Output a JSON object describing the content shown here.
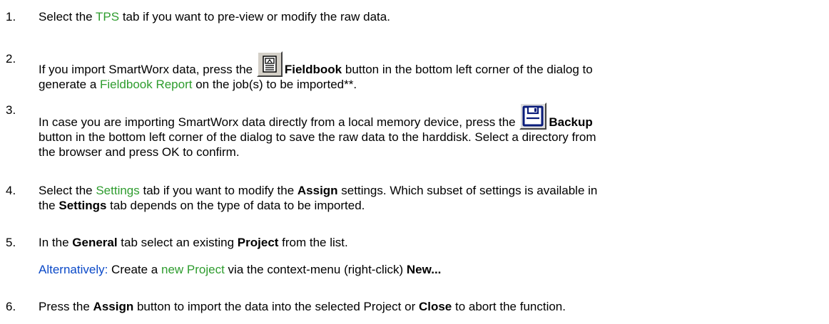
{
  "steps": [
    {
      "number": "1.",
      "pre": "Select the ",
      "link": "TPS",
      "post": " tab if you want to pre-view or modify the raw data."
    },
    {
      "number": "2.",
      "pre": "If you import SmartWorx data, press the ",
      "button": "Fieldbook",
      "mid": " button in the bottom left corner of the dialog to",
      "line2_pre": "generate a ",
      "link": "Fieldbook Report",
      "post": " on the job(s) to be imported**.",
      "icon": "fieldbook-icon"
    },
    {
      "number": "3.",
      "pre": "In case you are importing SmartWorx data directly from a local memory device, press the ",
      "button": "Backup",
      "line2": "button in the bottom left corner of the dialog to save the raw data to the harddisk. Select a directory from",
      "line3": "the browser and press OK to confirm.",
      "icon": "floppy-disk-icon"
    },
    {
      "number": "4.",
      "pre": "Select the ",
      "link": "Settings",
      "mid": " tab if you want to modify the ",
      "bold1": "Assign",
      "post": " settings. Which subset of settings is available in",
      "line2_pre": "the ",
      "bold2": "Settings",
      "line2_post": " tab depends on the type of data to be imported."
    },
    {
      "number": "5.",
      "pre": "In the ",
      "bold1": "General",
      "mid": " tab select an existing ",
      "bold2": "Project",
      "post": " from the list.",
      "alt_label": "Alternatively:",
      "alt_pre": " Create a ",
      "alt_link": "new Project",
      "alt_mid": " via the context-menu (right-click) ",
      "alt_bold": "New..."
    },
    {
      "number": "6.",
      "pre": "Press the ",
      "bold1": "Assign",
      "mid": " button to import the data into the selected Project or ",
      "bold2": "Close",
      "post": " to abort the function."
    }
  ],
  "colors": {
    "link": "#2e9c2e",
    "alt_label": "#0a49c8",
    "text": "#000000"
  }
}
